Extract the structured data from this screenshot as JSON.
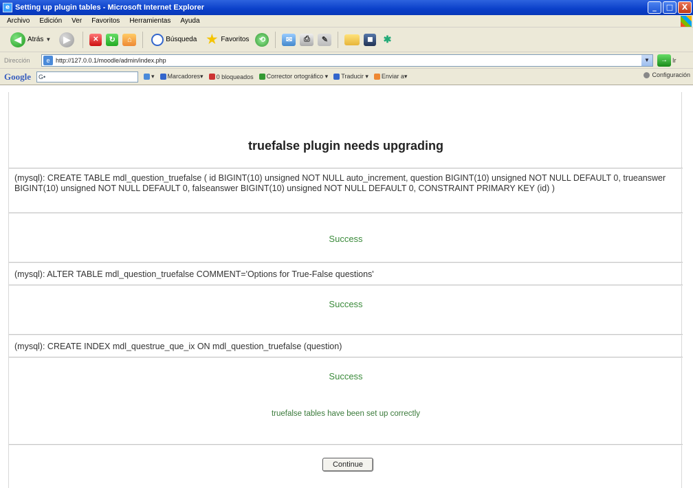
{
  "window": {
    "title": "Setting up plugin tables - Microsoft Internet Explorer",
    "buttons": [
      "_",
      "□",
      "X"
    ]
  },
  "menu": [
    "Archivo",
    "Edición",
    "Ver",
    "Favoritos",
    "Herramientas",
    "Ayuda"
  ],
  "toolbar": {
    "back_label": "Atrás",
    "search_label": "Búsqueda",
    "favorites_label": "Favoritos"
  },
  "address": {
    "label": "Dirección",
    "url": "http://127.0.0.1/moodle/admin/index.php",
    "go_label": "Ir"
  },
  "google_bar": {
    "logo": "Google",
    "search_value": "G•",
    "items": [
      "Marcadores▾",
      "0 bloqueados",
      "Corrector ortográfico ▾",
      "Traducir ▾",
      "Enviar a▾"
    ],
    "config_label": "Configuración"
  },
  "page": {
    "heading": "truefalse plugin needs upgrading",
    "sql1": "(mysql): CREATE TABLE mdl_question_truefalse ( id BIGINT(10) unsigned NOT NULL auto_increment, question BIGINT(10) unsigned NOT NULL DEFAULT 0, trueanswer BIGINT(10) unsigned NOT NULL DEFAULT 0, falseanswer BIGINT(10) unsigned NOT NULL DEFAULT 0, CONSTRAINT PRIMARY KEY (id) )",
    "success1": "Success",
    "sql2": "(mysql): ALTER TABLE mdl_question_truefalse COMMENT='Options for True-False questions'",
    "success2": "Success",
    "sql3": "(mysql): CREATE INDEX mdl_questrue_que_ix ON mdl_question_truefalse (question)",
    "success3": "Success",
    "notice": "truefalse tables have been set up correctly",
    "continue_label": "Continue"
  }
}
